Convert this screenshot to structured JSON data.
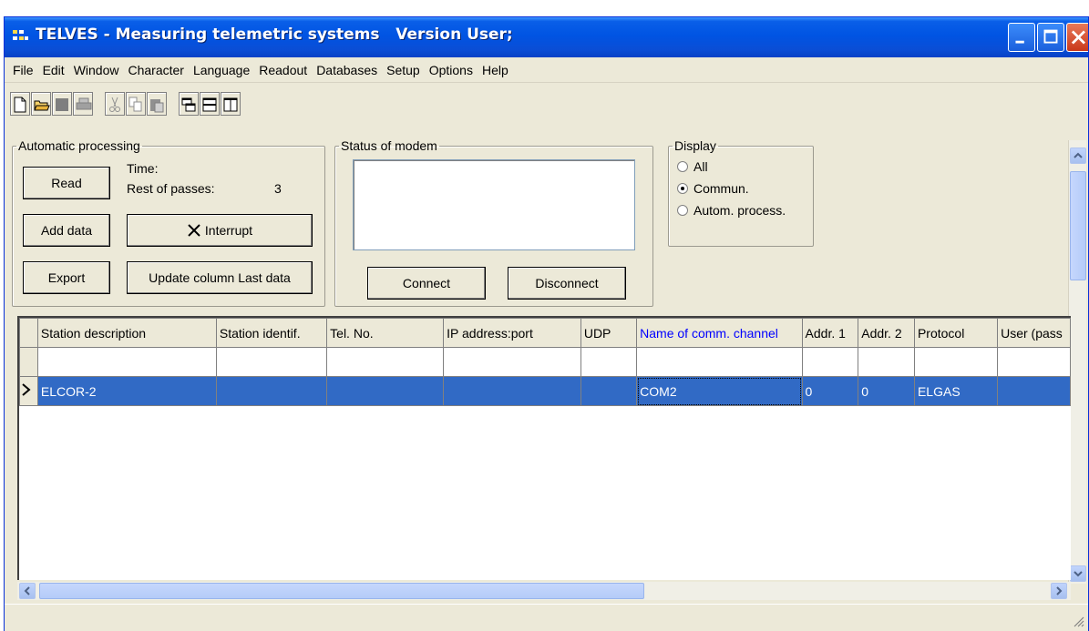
{
  "window": {
    "title": "TELVES - Measuring telemetric systems   Version User;"
  },
  "menu": [
    "File",
    "Edit",
    "Window",
    "Character",
    "Language",
    "Readout",
    "Databases",
    "Setup",
    "Options",
    "Help"
  ],
  "toolbar": {
    "icons": [
      "new-document-icon",
      "open-folder-icon",
      "save-icon",
      "print-icon",
      "cut-icon",
      "copy-icon",
      "paste-icon",
      "cascade-icon",
      "tile-horizontal-icon",
      "tile-vertical-icon"
    ]
  },
  "automatic_processing": {
    "legend": "Automatic processing",
    "time_label": "Time:",
    "rest_label": "Rest of passes:",
    "rest_value": "3",
    "read_button": "Read",
    "add_data_button": "Add data",
    "interrupt_button": "Interrupt",
    "export_button": "Export",
    "update_button": "Update column Last data"
  },
  "modem": {
    "legend": "Status of modem",
    "status_text": "",
    "connect_button": "Connect",
    "disconnect_button": "Disconnect"
  },
  "display": {
    "legend": "Display",
    "options": [
      "All",
      "Commun.",
      "Autom. process."
    ],
    "selected": "Commun."
  },
  "grid": {
    "columns": [
      "Station description",
      "Station identif.",
      "Tel. No.",
      "IP address:port",
      "UDP",
      "Name of comm. channel",
      "Addr. 1",
      "Addr. 2",
      "Protocol",
      "User (pass"
    ],
    "active_column": "Name of comm. channel",
    "selected_row": {
      "station_description": "ELCOR-2",
      "station_identif": "",
      "tel_no": "",
      "ip_address_port": "",
      "udp": "",
      "comm_channel": "COM2",
      "addr1": "0",
      "addr2": "0",
      "protocol": "ELGAS",
      "user_pass": ""
    }
  },
  "colors": {
    "titlebar": "#0054e3",
    "selection": "#316ac5",
    "active_header_text": "#0000ff",
    "face": "#ece9d8"
  }
}
